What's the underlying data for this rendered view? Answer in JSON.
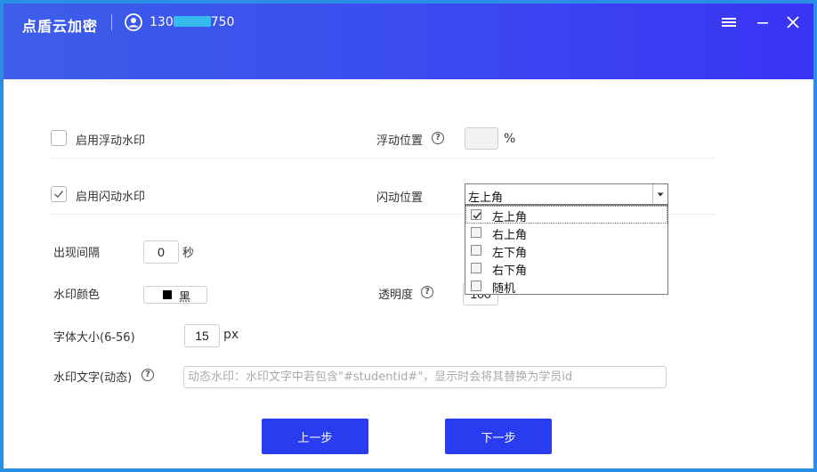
{
  "app": {
    "title": "点盾云加密",
    "user_phone_prefix": "130",
    "user_phone_suffix": "750"
  },
  "window_controls": {
    "menu_icon": "hamburger-menu-icon",
    "minimize_icon": "minimize-icon",
    "close_icon": "close-icon"
  },
  "float_watermark": {
    "label": "启用浮动水印",
    "checked": false,
    "position_label": "浮动位置",
    "position_value": "",
    "position_unit": "%"
  },
  "flash_watermark": {
    "label": "启用闪动水印",
    "checked": true,
    "position_label": "闪动位置",
    "position_selected": "左上角",
    "position_options": [
      {
        "label": "左上角",
        "checked": true
      },
      {
        "label": "右上角",
        "checked": false
      },
      {
        "label": "左下角",
        "checked": false
      },
      {
        "label": "右下角",
        "checked": false
      },
      {
        "label": "随机",
        "checked": false
      }
    ]
  },
  "interval": {
    "label": "出现间隔",
    "value": "0",
    "unit": "秒"
  },
  "color": {
    "label": "水印颜色",
    "swatch": "#000000",
    "name": "黑"
  },
  "opacity": {
    "label": "透明度",
    "value": "100"
  },
  "font_size": {
    "label": "字体大小(6-56)",
    "value": "15",
    "unit": "px"
  },
  "watermark_text": {
    "label": "水印文字(动态)",
    "value": "",
    "placeholder": "动态水印：水印文字中若包含\"#studentid#\"，显示时会将其替换为学员id"
  },
  "buttons": {
    "prev": "上一步",
    "next": "下一步"
  },
  "colors": {
    "titlebar_start": "#3d5ee8",
    "titlebar_end": "#3a34f4",
    "button": "#2a3cf0",
    "window_border": "#2a8ee6"
  }
}
